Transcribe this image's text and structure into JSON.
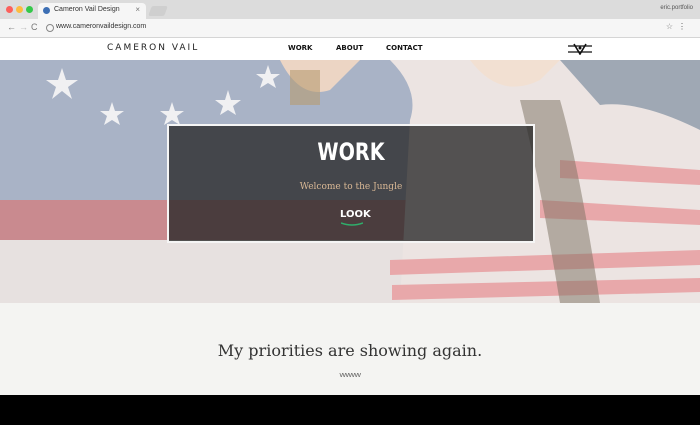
{
  "browser": {
    "tab_title": "Cameron Vail Design",
    "tab_close": "×",
    "profile_name": "eric.portfolio",
    "url": "www.cameronvaildesign.com",
    "nav_back": "←",
    "nav_forward": "→",
    "nav_reload": "C",
    "bookmark_icon": "☆",
    "menu_icon": "⋮"
  },
  "site": {
    "logo": "CAMERON VAIL",
    "nav": [
      "WORK",
      "ABOUT",
      "CONTACT"
    ]
  },
  "hero": {
    "title": "WORK",
    "subtitle": "Welcome to the Jungle",
    "cta": "LOOK"
  },
  "section": {
    "tagline": "My priorities are showing again.",
    "chevrons": "vvvvvvv"
  },
  "colors": {
    "accent_green": "#2fae6b",
    "subtitle_tan": "#d9b895"
  }
}
